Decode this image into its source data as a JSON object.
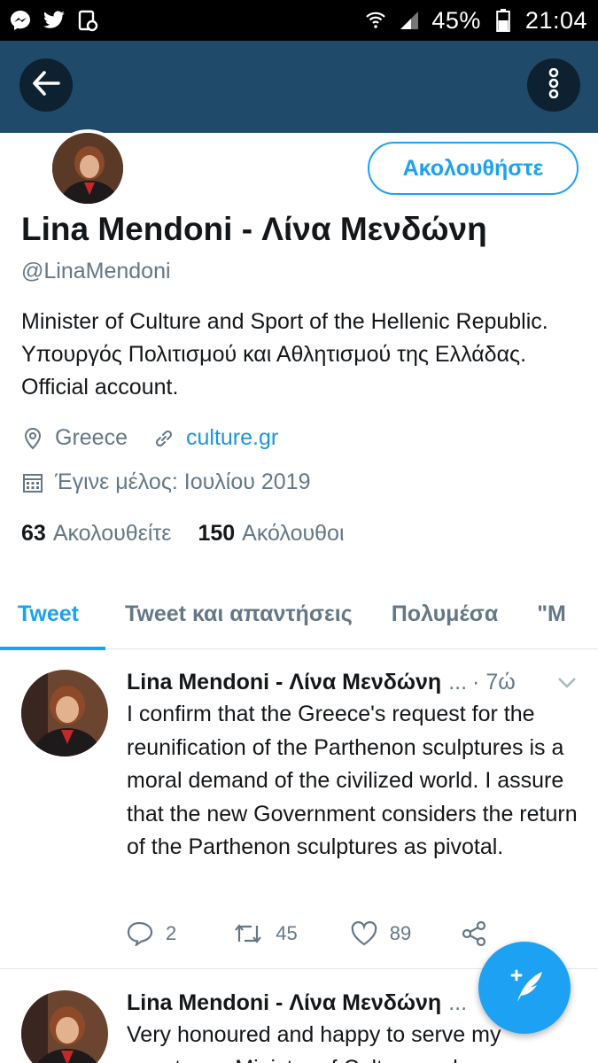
{
  "status_bar": {
    "left_icons": [
      "messenger-icon",
      "twitter-icon",
      "notification-icon"
    ],
    "battery": "45%",
    "time": "21:04"
  },
  "app_bar": {
    "back_icon": "arrow-left-icon",
    "more_icon": "more-vertical-icon",
    "color": "#1f4a6a"
  },
  "profile": {
    "follow_label": "Ακολουθήστε",
    "name": "Lina Mendoni - Λίνα Μενδώνη",
    "handle": "@LinaMendoni",
    "bio": "Minister of Culture and Sport of the  Hellenic Republic. Υπουργός Πολιτισμού και Αθλητισμού της Ελλάδας.   Official account.",
    "location": "Greece",
    "website": "culture.gr",
    "joined": "Έγινε μέλος: Ιουλίου 2019",
    "following_count": "63",
    "following_label": "Ακολουθείτε",
    "followers_count": "150",
    "followers_label": "Ακόλουθοι"
  },
  "tabs": [
    {
      "label": "Tweet",
      "active": true
    },
    {
      "label": "Tweet και απαντήσεις",
      "active": false
    },
    {
      "label": "Πολυμέσα",
      "active": false
    },
    {
      "label": "\"M",
      "active": false
    }
  ],
  "tweets": [
    {
      "author": "Lina Mendoni - Λίνα Μενδώνη",
      "ellipsis": "...",
      "time": "· 7ώ",
      "text": "I confirm that the Greece's request for the reunification of the Parthenon sculptures is a moral demand of the civilized world. I assure that the new Government considers the return of the Parthenon sculptures as pivotal.",
      "replies": "2",
      "retweets": "45",
      "likes": "89"
    },
    {
      "author": "Lina Mendoni - Λίνα Μενδώνη",
      "ellipsis": "...",
      "text": "Very honoured and happy to serve my country as Minister of Culture and"
    }
  ],
  "fab": {
    "icon": "compose-tweet-icon"
  },
  "colors": {
    "accent": "#1da1f2",
    "link": "#1b95e0",
    "muted": "#657786"
  }
}
